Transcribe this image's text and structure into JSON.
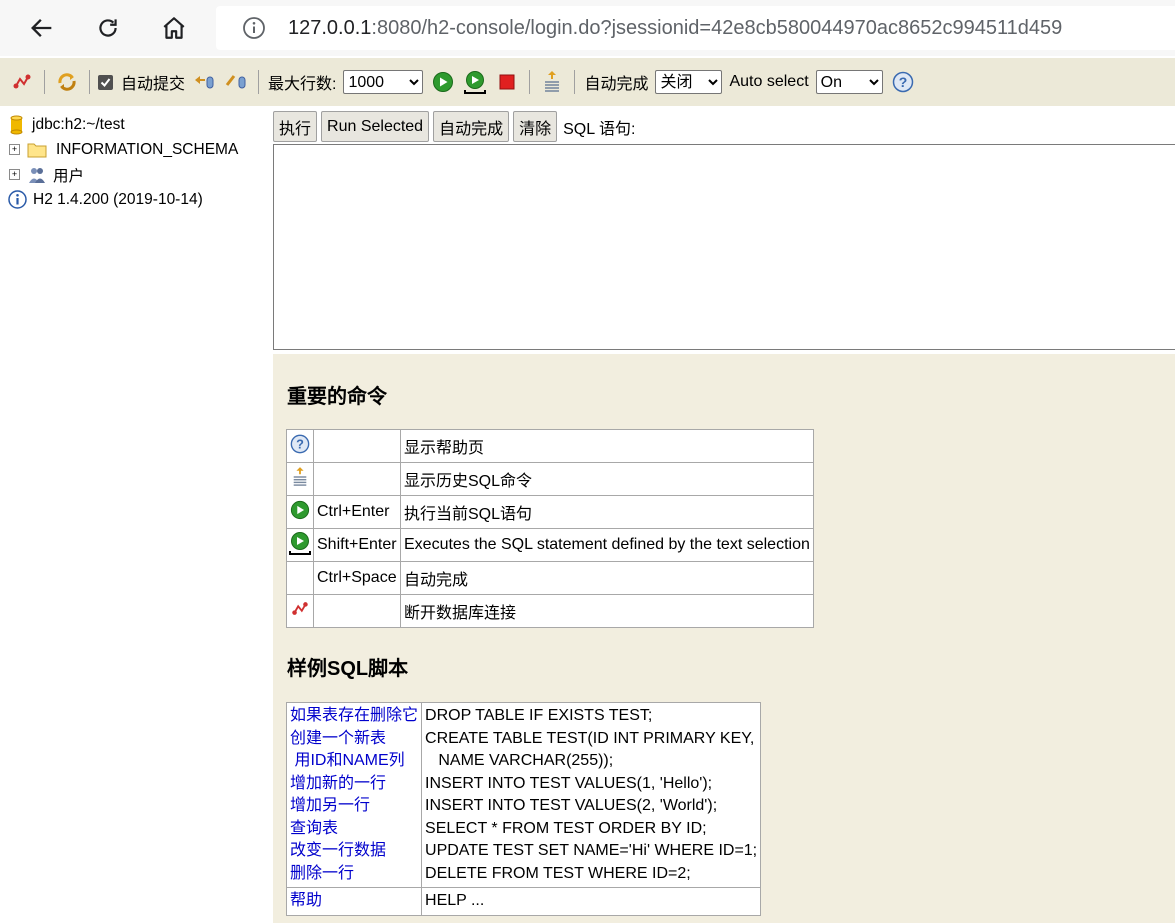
{
  "browser": {
    "url_host": "127.0.0.1",
    "url_rest": ":8080/h2-console/login.do?jsessionid=42e8cb580044970ac8652c994511d459"
  },
  "toolbar": {
    "autocommit_label": "自动提交",
    "autocommit_checked": true,
    "max_rows_label": "最大行数:",
    "max_rows_value": "1000",
    "autocomplete_label": "自动完成",
    "autocomplete_value": "关闭",
    "autoselect_label": "Auto select",
    "autoselect_value": "On"
  },
  "tree": {
    "connection": "jdbc:h2:~/test",
    "schema": "INFORMATION_SCHEMA",
    "users": "用户",
    "version": "H2 1.4.200 (2019-10-14)"
  },
  "sql": {
    "execute_label": "执行",
    "run_selected_label": "Run Selected",
    "autocomplete_label": "自动完成",
    "clear_label": "清除",
    "statement_label": "SQL 语句:"
  },
  "help": {
    "important_title": "重要的命令",
    "commands": [
      {
        "icon": "help-icon",
        "key": "",
        "desc": "显示帮助页"
      },
      {
        "icon": "history-icon",
        "key": "",
        "desc": "显示历史SQL命令"
      },
      {
        "icon": "run-icon",
        "key": "Ctrl+Enter",
        "desc": "执行当前SQL语句"
      },
      {
        "icon": "run-selected-icon",
        "key": "Shift+Enter",
        "desc": "Executes the SQL statement defined by the text selection"
      },
      {
        "icon": "",
        "key": "Ctrl+Space",
        "desc": "自动完成"
      },
      {
        "icon": "disconnect-icon",
        "key": "",
        "desc": "断开数据库连接"
      }
    ],
    "sample_title": "样例SQL脚本",
    "samples": [
      {
        "label": "如果表存在删除它",
        "code": "DROP TABLE IF EXISTS TEST;"
      },
      {
        "label": "创建一个新表",
        "code": "CREATE TABLE TEST(ID INT PRIMARY KEY,"
      },
      {
        "label": " 用ID和NAME列",
        "code": "   NAME VARCHAR(255));"
      },
      {
        "label": "增加新的一行",
        "code": "INSERT INTO TEST VALUES(1, 'Hello');"
      },
      {
        "label": "增加另一行",
        "code": "INSERT INTO TEST VALUES(2, 'World');"
      },
      {
        "label": "查询表",
        "code": "SELECT * FROM TEST ORDER BY ID;"
      },
      {
        "label": "改变一行数据",
        "code": "UPDATE TEST SET NAME='Hi' WHERE ID=1;"
      },
      {
        "label": "删除一行",
        "code": "DELETE FROM TEST WHERE ID=2;"
      }
    ],
    "help_label": "帮助",
    "help_code": "HELP ..."
  }
}
